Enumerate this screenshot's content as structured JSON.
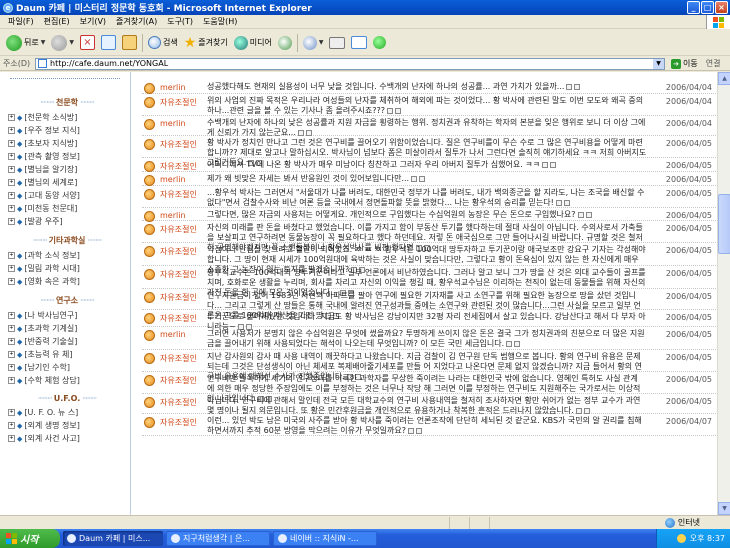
{
  "window": {
    "title": "Daum 카페 | 미스터리 정문학 동호회 - Microsoft Internet Explorer"
  },
  "menu": {
    "items": [
      "파일(F)",
      "편집(E)",
      "보기(V)",
      "즐겨찾기(A)",
      "도구(T)",
      "도움말(H)"
    ]
  },
  "toolbar": {
    "back_label": "뒤로",
    "search_label": "검색",
    "favorites_label": "즐겨찾기",
    "media_label": "미디어"
  },
  "address": {
    "label": "주소(D)",
    "url": "http://cafe.daum.net/YONGAL",
    "go_label": "이동",
    "links_label": "연결"
  },
  "sidebar": {
    "sections": [
      {
        "heading": "",
        "items": []
      },
      {
        "heading": "천문학",
        "items": [
          "[천문학 소식방]",
          "[우주 정보 지식]",
          "[초보자 지식방]",
          "[관측 촬영 정보]",
          "[별님을 알기장]",
          "[별님의 세계로]",
          "[고대 동양 서양]",
          "[미천동 천문대]",
          "[발광 우주]"
        ]
      },
      {
        "heading": "기타과학실",
        "items": [
          "[과학 소식 정보]",
          "[밀림 과학 시대]",
          "[영화 속은 과학]"
        ]
      },
      {
        "heading": "연구소",
        "items": [
          "[나 박사님연구]",
          "[초과학 기계실]",
          "[반중력 기술실]",
          "[초능력 유 체]",
          "[남기인 수학]",
          "[수학 체험 상담]"
        ]
      },
      {
        "heading": "U.F.O.",
        "items": [
          "[U. F. O. 뉴 스]",
          "[외계 생명 정보]",
          "[외계 사건 사고]"
        ]
      }
    ]
  },
  "comments": [
    {
      "author": "merlin",
      "text": "성공했다해도 현재의 실용성이 너무 낮을 것입니다. 수백개의 난자에 하나의 성공률... 과연 가치가 있을까...",
      "date": "2006/04/04"
    },
    {
      "author": "자유조절인",
      "text": "위의 사업의 진짜 목적은 우리나라 여성들의 난자를 체취하여 해외에 파는 것이었다... 황 박사에 관련된 말도 이번 모도와 왜곡 중의 하나...관련 글을 볼 수 있는 기사나 좀 올려주시죠???",
      "date": "2006/04/04"
    },
    {
      "author": "merlin",
      "text": "수백개의 난자에 하나의 낮은 성공률과 지원 자금을 횡령하는 행위. 정치권과 유착하는 학자의 본분을 잊은 행위로 보니 더 이상 그에게 신뢰가 가지 않는군요...",
      "date": "2006/04/04"
    },
    {
      "author": "자유조절인",
      "text": "황 박사가 정치인 만나고 그런 것은 연구비를 끌어오기 위함이었습니다. 질은 연구비를이 무슨 수로 그 많은 연구비용을 어떻게 마련 합니까?? 제대로 알고나 말하십시오. 박사님이 넘보다 폼은 미살이라서 질투가 나서 그런다면 솔직히 얘기하세요 ㅋㅋ 저희 아버지도 그렇거든요.",
      "date": "2006/04/05"
    },
    {
      "author": "자유조절인",
      "text": "어머니께서 TV에 나온 황 박사가 매우 미남이다 칭찬하고 그러자 우리 아버지 질투가 심했어요. ㅋㅋ",
      "date": "2006/04/05"
    },
    {
      "author": "merlin",
      "text": "제가 왜 빗맞은 자세는 봐서 반응원인 것이 있어보입니다만...",
      "date": "2006/04/05"
    },
    {
      "author": "자유조절인",
      "text": "...황우석 박사는 그러면서 \"서울대가 나를 버려도, 대한민국 정부가 나를 버려도, 내가 백의종군을 할 지라도, 나는 조국을 배신할 수 없다\"면서 검찰수사와 비난 여론 등을 국내에서 정면돌파할 뜻을 밝혔다... 나는 황우석의 숭리를 믿는다!",
      "date": "2006/04/05"
    },
    {
      "author": "merlin",
      "text": "그렇다면, 많은 자금의 사용처는 어떻게요. 개인적으로 구입했다는 수십억원의 농장은 무슨 돈으로 구입했나요?",
      "date": "2006/04/05"
    },
    {
      "author": "자유조절인",
      "text": "자신의 미래를 판 돈을 바쳤다고 했었습니다. 이를 가지고 함이 부동산 투기를 했다하는데 절대 사실이 아닙니다. 수의사로서 가축들을 보살피고 연구하려면 동물농장이 꼭 필요하다고 했다 하던데요. 저렇 돈 애국심으로 그만 들어나시길 바랍니다. 규명할 것은 철저히 규명해야겠지만 꼭 스캔들붙이나 황우석박사를 비판 한다면",
      "date": "2006/04/05"
    },
    {
      "author": "자유조절인",
      "text": "약점이나 단점을 찾으려고 혈안이 되어있죠. ㅉ ㅉ ㅉ 황우석은 100억대 땅투자하고 투기꾼이랑 애국보조만 강요구 기자는 각성해야 합니다. 그 땅이 현재 시세가 100억원대에 육박하는 것은 사실이 맞습니다만, 그렇다고 황이 돈욕심이 있지 않는 한 자신에게 매우 소중한 그 농장이 있는 토지를 팔겠습니까?",
      "date": "2006/04/05"
    },
    {
      "author": "자유조절인",
      "text": "황우석교수는 100억대의 땅투기꾼이라고 일부 언론에서 비난하였습니다. 그러나 알고 보니 그가 땅을 산 것은 의대 교수들이 골프를 치며, 호화로운 생활을 누리며, 회사를 차리고 자신의 이익을 챙길 때, 황우석교수님은 이리하는 천직이 없는데 동물들을 위해 자신의 가진 돈을 한 곳에 모은 것이었습니다...",
      "date": "2006/04/05"
    },
    {
      "author": "자유조절인",
      "text": "연구지원금이 없어 1983년 자신의 아파트를 팔아 연구에 필요한 기자재를 사고 소연구를 위해 필요한 농장으로 땅을 샀던 것입니다... 그리고 그렇게 산 땅들은 통해 국내에 알려진 연구성과들 중에는 소연구와 관련된 것이 많습니다...그런 사실을 모르고 일부 언론은 그를 100억대 재산을 가진 땅",
      "date": "2006/04/05"
    },
    {
      "author": "자유조절인",
      "text": "투기꾼으로 몰아세웠던 것입니다. 지금도 황 박사님은 강남이지만 32평 자리 전세집에서 살고 있습니다. 강남산다고 해서 다 부자 아니라능~",
      "date": "2006/04/05"
    },
    {
      "author": "merlin",
      "text": "그러면 사용처가 분명치 않은 수십억원은 무엇에 썼을까요? 투명하게 쓰이지 않은 돈은 결국 그가 정치권과의 친분으로 더 많은 지원금을 끌어내기 위해 사용되었다는 해석이 나오는데 무엇입니까? 이 모든 국민 세금입니다.",
      "date": "2006/04/05"
    },
    {
      "author": "자유조절인",
      "text": "지난 감사원의 감사 때 사용 내역이 깨끗하다고 나왔습니다. 지금 검찰이 김 연구원 단독 범행으로 봅니다. 황의 연구비 유용은 문제되는데 그것은 단성생식이 아닌 체세포 복제배아줄기세포를 만들 어 지었다고 나온다면 문제 없지 않겠습니까? 지금 들어서 황의 연구비 유용에 대해선 수사가 진행중입니다.",
      "date": "2006/04/05"
    },
    {
      "author": "자유조절인",
      "text": "연구비만 들쭉하게 세기의 연구성과를 이룩한 과학자를 무상한 죽이려는 나라는 대한민국 밖에 없습니다. 영혜인 특허도 사실 관계 에 의한 매우 정당한 주장임에도 이를 부정하는 것은 너무나 작당 해 그러면 이를 부정하는 연구비도 지원해주는 국가로서는 이상적인 나라입니다.",
      "date": "2006/04/05"
    },
    {
      "author": "자유조절인",
      "text": "아닙니다. 연구비에 관해서 말인데 전국 모든 대학교수의 연구비 사용내역을 철저히 조사하자면 황만 쉬어가 없는 정부 교수가 과연 몇 명이나 될지 의문입니다. 또 황은 민간후원금을 개인적으로 유용하거나 착복한 흔적은 드러나지 않았습니다.",
      "date": "2006/04/05"
    },
    {
      "author": "자유조절인",
      "text": "이런... 있던 박도 남은 미국의 사주를 받아 황 박사를 죽이려는 언론조작에 단단히 세뇌된 것 같군요. KBS가 국민의 알 권리를 침해하면서까지 추적 60분 방영을 막으려는 이유가 무엇일까요?",
      "date": "2006/04/07"
    }
  ],
  "status": {
    "zone": "인터넷"
  },
  "taskbar": {
    "start": "시작",
    "tasks": [
      "Daum 카페 | 미스...",
      "지구처럼생각 | 은...",
      "네이버 :: 지식iN -..."
    ],
    "clock": "오후 8:37"
  }
}
